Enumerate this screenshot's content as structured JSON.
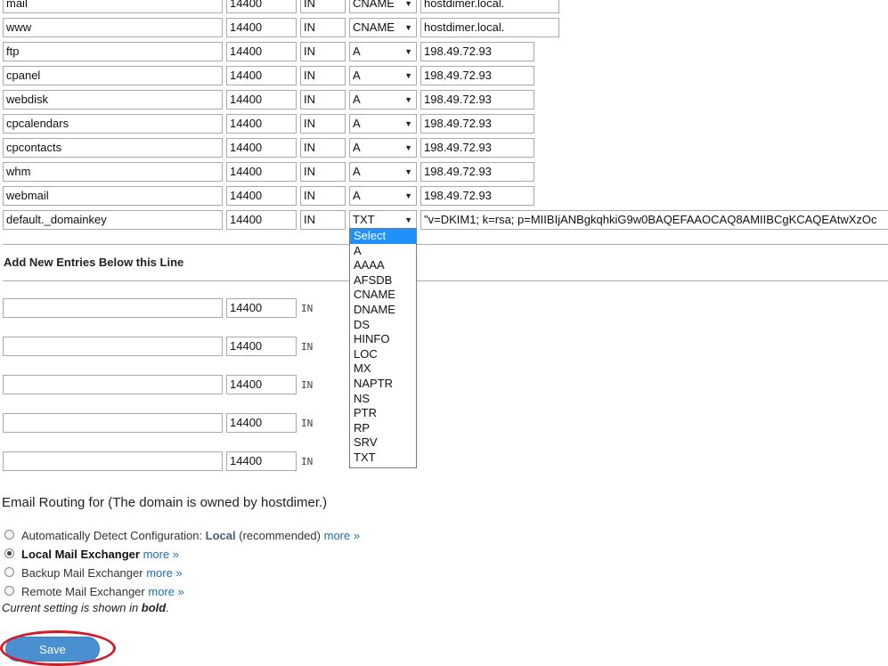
{
  "records": [
    {
      "name": "mail",
      "ttl": "14400",
      "class": "IN",
      "type": "CNAME",
      "value": "hostdimer.local."
    },
    {
      "name": "www",
      "ttl": "14400",
      "class": "IN",
      "type": "CNAME",
      "value": "hostdimer.local."
    },
    {
      "name": "ftp",
      "ttl": "14400",
      "class": "IN",
      "type": "A",
      "value": "198.49.72.93"
    },
    {
      "name": "cpanel",
      "ttl": "14400",
      "class": "IN",
      "type": "A",
      "value": "198.49.72.93"
    },
    {
      "name": "webdisk",
      "ttl": "14400",
      "class": "IN",
      "type": "A",
      "value": "198.49.72.93"
    },
    {
      "name": "cpcalendars",
      "ttl": "14400",
      "class": "IN",
      "type": "A",
      "value": "198.49.72.93"
    },
    {
      "name": "cpcontacts",
      "ttl": "14400",
      "class": "IN",
      "type": "A",
      "value": "198.49.72.93"
    },
    {
      "name": "whm",
      "ttl": "14400",
      "class": "IN",
      "type": "A",
      "value": "198.49.72.93"
    },
    {
      "name": "webmail",
      "ttl": "14400",
      "class": "IN",
      "type": "A",
      "value": "198.49.72.93"
    },
    {
      "name": "default._domainkey",
      "ttl": "14400",
      "class": "IN",
      "type": "TXT",
      "value": "\"v=DKIM1; k=rsa; p=MIIBIjANBgkqhkiG9w0BAQEFAAOCAQ8AMIIBCgKCAQEAtwXzOc"
    }
  ],
  "new_entries": {
    "heading": "Add New Entries Below this Line",
    "rows": [
      {
        "name": "",
        "ttl": "14400",
        "class": "IN"
      },
      {
        "name": "",
        "ttl": "14400",
        "class": "IN"
      },
      {
        "name": "",
        "ttl": "14400",
        "class": "IN"
      },
      {
        "name": "",
        "ttl": "14400",
        "class": "IN"
      },
      {
        "name": "",
        "ttl": "14400",
        "class": "IN"
      }
    ]
  },
  "type_dropdown": {
    "highlighted": "Select",
    "options": [
      "Select",
      "A",
      "AAAA",
      "AFSDB",
      "CNAME",
      "DNAME",
      "DS",
      "HINFO",
      "LOC",
      "MX",
      "NAPTR",
      "NS",
      "PTR",
      "RP",
      "SRV",
      "TXT"
    ]
  },
  "email_routing": {
    "title": "Email Routing for (The domain is owned by hostdimer.)",
    "options": [
      {
        "label": "Automatically Detect Configuration: ",
        "detected": "Local",
        "suffix": " (recommended)",
        "more": "more »",
        "checked": false,
        "bold": false
      },
      {
        "label": "Local Mail Exchanger",
        "more": "more »",
        "checked": true,
        "bold": true
      },
      {
        "label": "Backup Mail Exchanger",
        "more": "more »",
        "checked": false,
        "bold": false
      },
      {
        "label": "Remote Mail Exchanger",
        "more": "more »",
        "checked": false,
        "bold": false
      }
    ],
    "note_prefix": "Current setting is shown in ",
    "note_bold": "bold",
    "note_suffix": "."
  },
  "save_label": "Save",
  "colors": {
    "accent": "#4a90d0",
    "link": "#1a6fb3",
    "highlight": "#1e90ff",
    "ring": "#d21a2a"
  }
}
